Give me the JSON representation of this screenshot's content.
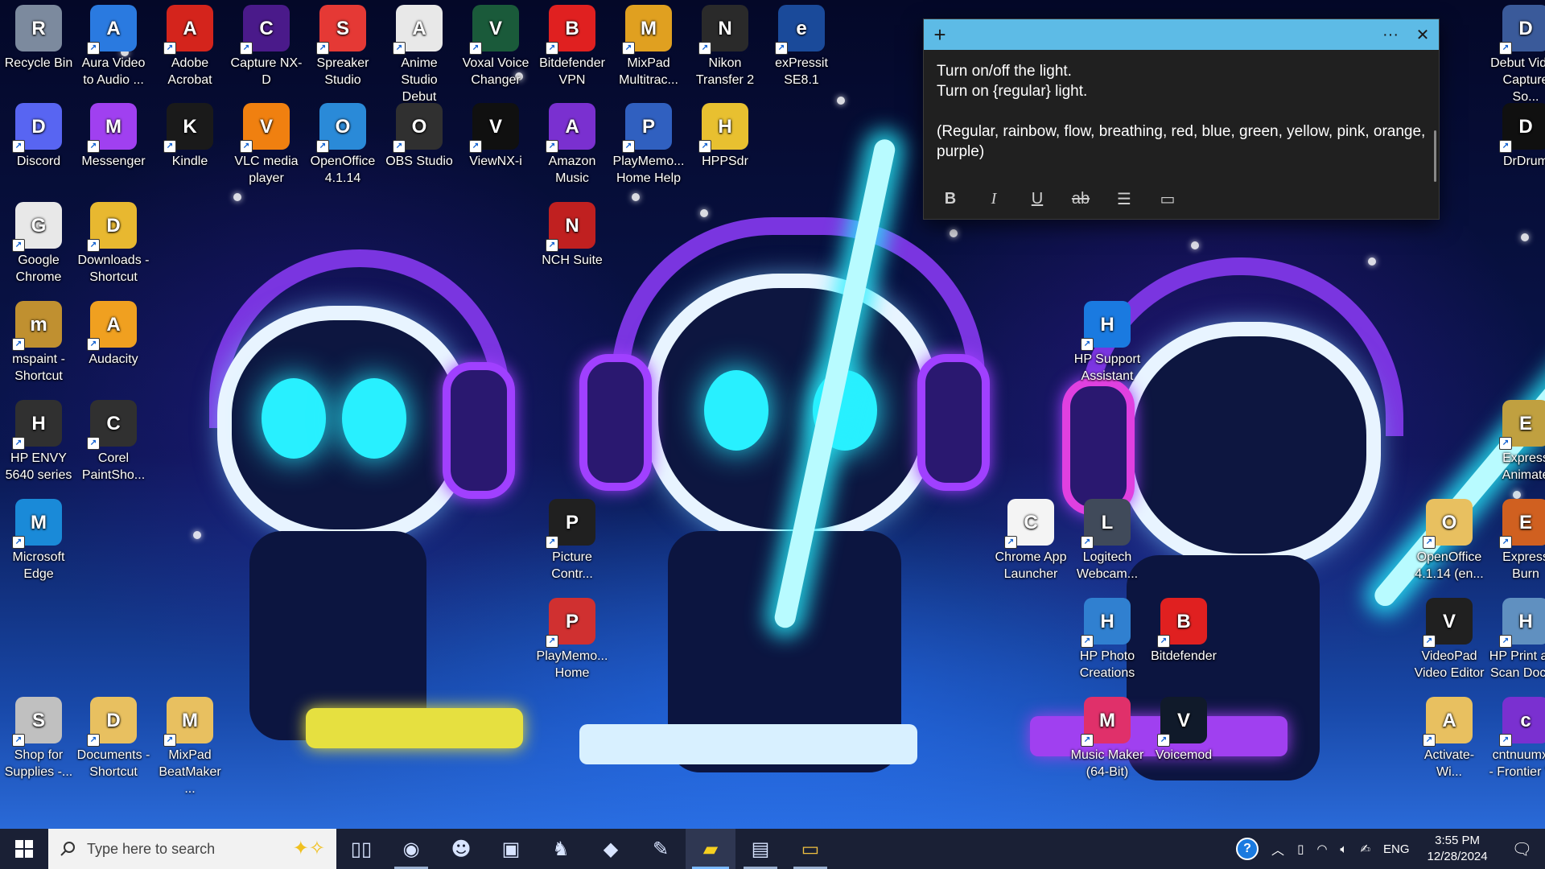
{
  "desktop_icons": [
    {
      "label": "Recycle Bin",
      "icon": "recycle-bin-icon",
      "color": "#7c8a9e"
    },
    {
      "label": "Aura Video to Audio ...",
      "icon": "aura-video-icon",
      "color": "#2a7ae0"
    },
    {
      "label": "Adobe Acrobat",
      "icon": "adobe-acrobat-icon",
      "color": "#d4241c"
    },
    {
      "label": "Capture NX-D",
      "icon": "capture-nxd-icon",
      "color": "#4a1a8a"
    },
    {
      "label": "Spreaker Studio",
      "icon": "spreaker-icon",
      "color": "#e53935"
    },
    {
      "label": "Anime Studio Debut",
      "icon": "anime-studio-icon",
      "color": "#e8e8e8"
    },
    {
      "label": "Voxal Voice Changer",
      "icon": "voxal-icon",
      "color": "#1a5a3a"
    },
    {
      "label": "Bitdefender VPN",
      "icon": "bitdefender-vpn-icon",
      "color": "#e02020"
    },
    {
      "label": "MixPad Multitrac...",
      "icon": "mixpad-icon",
      "color": "#e0a020"
    },
    {
      "label": "Nikon Transfer 2",
      "icon": "nikon-transfer-icon",
      "color": "#2a2a2a"
    },
    {
      "label": "exPressit SE8.1",
      "icon": "expressit-icon",
      "color": "#1a4a9a"
    },
    {
      "label": "Debut Video Capture So...",
      "icon": "debut-video-icon",
      "color": "#3a5a9a"
    },
    {
      "label": "Discord",
      "icon": "discord-icon",
      "color": "#5865f2"
    },
    {
      "label": "Messenger",
      "icon": "messenger-icon",
      "color": "#a040f0"
    },
    {
      "label": "Kindle",
      "icon": "kindle-icon",
      "color": "#1a1a1a"
    },
    {
      "label": "VLC media player",
      "icon": "vlc-icon",
      "color": "#f08010"
    },
    {
      "label": "OpenOffice 4.1.14",
      "icon": "openoffice-icon",
      "color": "#2a8ad8"
    },
    {
      "label": "OBS Studio",
      "icon": "obs-icon",
      "color": "#303030"
    },
    {
      "label": "ViewNX-i",
      "icon": "viewnx-icon",
      "color": "#101010"
    },
    {
      "label": "Amazon Music",
      "icon": "amazon-music-icon",
      "color": "#7a30d0"
    },
    {
      "label": "PlayMemo... Home Help",
      "icon": "help-icon",
      "color": "#3060c0"
    },
    {
      "label": "HPPSdr",
      "icon": "hppsdr-icon",
      "color": "#e8c030"
    },
    {
      "label": "DrDrum",
      "icon": "drdrum-icon",
      "color": "#101010"
    },
    {
      "label": "Google Chrome",
      "icon": "chrome-icon",
      "color": "#e8e8e8"
    },
    {
      "label": "Downloads - Shortcut",
      "icon": "folder-icon",
      "color": "#e8b830"
    },
    {
      "label": "NCH Suite",
      "icon": "nch-suite-icon",
      "color": "#c02020"
    },
    {
      "label": "mspaint - Shortcut",
      "icon": "mspaint-icon",
      "color": "#c09030"
    },
    {
      "label": "Audacity",
      "icon": "audacity-icon",
      "color": "#f0a020"
    },
    {
      "label": "HP Support Assistant",
      "icon": "help-icon",
      "color": "#1a7ae0"
    },
    {
      "label": "HP ENVY 5640 series",
      "icon": "printer-icon",
      "color": "#303030"
    },
    {
      "label": "Corel PaintSho...",
      "icon": "paintshop-icon",
      "color": "#303030"
    },
    {
      "label": "Express Animate",
      "icon": "express-animate-icon",
      "color": "#c0a040"
    },
    {
      "label": "Microsoft Edge",
      "icon": "edge-icon",
      "color": "#1a8ad8"
    },
    {
      "label": "Picture Contr...",
      "icon": "picture-control-icon",
      "color": "#202020"
    },
    {
      "label": "Chrome App Launcher",
      "icon": "app-launcher-icon",
      "color": "#f4f4f4"
    },
    {
      "label": "Logitech Webcam...",
      "icon": "webcam-icon",
      "color": "#404a5a"
    },
    {
      "label": "OpenOffice 4.1.14 (en...",
      "icon": "folder-icon",
      "color": "#e8c060"
    },
    {
      "label": "Express Burn",
      "icon": "express-burn-icon",
      "color": "#d06020"
    },
    {
      "label": "PlayMemo... Home",
      "icon": "playmemories-icon",
      "color": "#d03030"
    },
    {
      "label": "HP Photo Creations",
      "icon": "hp-photo-icon",
      "color": "#3080d0"
    },
    {
      "label": "Bitdefender",
      "icon": "bitdefender-icon",
      "color": "#e02020"
    },
    {
      "label": "VideoPad Video Editor",
      "icon": "videopad-icon",
      "color": "#202020"
    },
    {
      "label": "HP Print and Scan Doctor",
      "icon": "hp-doctor-icon",
      "color": "#6090c0"
    },
    {
      "label": "Shop for Supplies -...",
      "icon": "shop-printer-icon",
      "color": "#c0c0c0"
    },
    {
      "label": "Documents - Shortcut",
      "icon": "documents-folder-icon",
      "color": "#e8c060"
    },
    {
      "label": "MixPad BeatMaker ...",
      "icon": "folder-icon",
      "color": "#e8c060"
    },
    {
      "label": "Music Maker (64-Bit)",
      "icon": "music-maker-icon",
      "color": "#e0306a"
    },
    {
      "label": "Voicemod",
      "icon": "voicemod-icon",
      "color": "#101a2a"
    },
    {
      "label": "Activate-Wi...",
      "icon": "folder-icon",
      "color": "#e8c060"
    },
    {
      "label": "cntnuumx... - Frontier Y...",
      "icon": "mail-icon",
      "color": "#7a30d0"
    }
  ],
  "sticky_note": {
    "new_label": "+",
    "menu_label": "···",
    "close_label": "✕",
    "lines": [
      "Turn on/off the light.",
      "Turn on {regular} light.",
      "",
      "(Regular, rainbow, flow, breathing, red, blue, green, yellow, pink, orange, purple)"
    ],
    "toolbar": {
      "bold": "B",
      "italic": "I",
      "underline": "U",
      "strike": "ab",
      "list": "☰",
      "image": "▭"
    },
    "header_color": "#5dbbe6"
  },
  "taskbar": {
    "search_placeholder": "Type here to search",
    "apps": [
      {
        "name": "task-view",
        "glyph": "▯▯",
        "state": "none"
      },
      {
        "name": "chrome",
        "glyph": "◉",
        "state": "open"
      },
      {
        "name": "app-2",
        "glyph": "☻",
        "state": "none"
      },
      {
        "name": "app-3",
        "glyph": "▣",
        "state": "none"
      },
      {
        "name": "kindle",
        "glyph": "♞",
        "state": "none"
      },
      {
        "name": "app-5",
        "glyph": "◆",
        "state": "none"
      },
      {
        "name": "paint",
        "glyph": "✎",
        "state": "none"
      },
      {
        "name": "sticky-notes",
        "glyph": "▰",
        "state": "active"
      },
      {
        "name": "app-8",
        "glyph": "▤",
        "state": "open"
      },
      {
        "name": "file-explorer",
        "glyph": "▭",
        "state": "open"
      }
    ],
    "tray": {
      "language": "ENG",
      "time": "3:55 PM",
      "date": "12/28/2024"
    }
  }
}
